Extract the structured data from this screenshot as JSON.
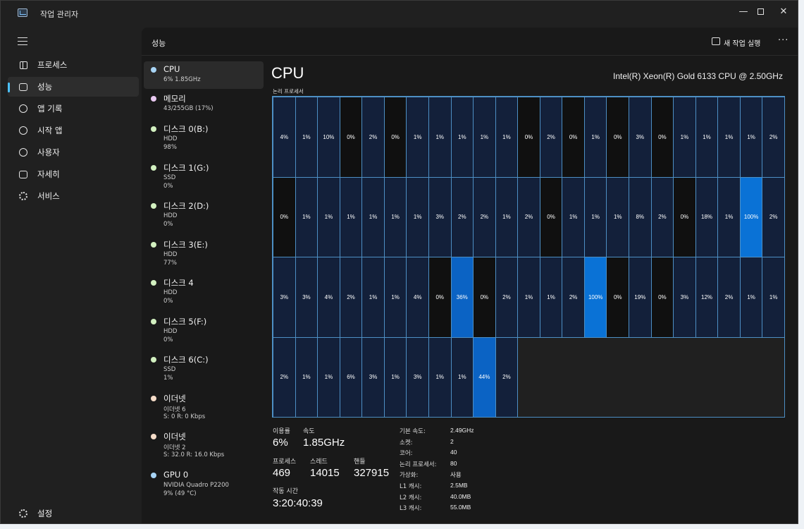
{
  "window": {
    "title": "작업 관리자",
    "min_glyph": "—",
    "close_glyph": "✕"
  },
  "nav": {
    "items": [
      {
        "label": "프로세스",
        "icon": "processes-icon"
      },
      {
        "label": "성능",
        "icon": "performance-icon",
        "active": true
      },
      {
        "label": "앱 기록",
        "icon": "app-history-icon"
      },
      {
        "label": "시작 앱",
        "icon": "startup-icon"
      },
      {
        "label": "사용자",
        "icon": "users-icon"
      },
      {
        "label": "자세히",
        "icon": "details-icon"
      },
      {
        "label": "서비스",
        "icon": "services-icon"
      }
    ],
    "settings_label": "설정"
  },
  "header": {
    "title": "성능",
    "run_task_label": "새 작업 실행",
    "more_glyph": "···"
  },
  "devices": [
    {
      "name": "CPU",
      "sub": "6% 1.85GHz",
      "sub2": "",
      "dot": "#a8d4f5",
      "active": true
    },
    {
      "name": "메모리",
      "sub": "43/255GB (17%)",
      "sub2": "",
      "dot": "#e8c8f0"
    },
    {
      "name": "디스크 0(B:)",
      "sub": "HDD",
      "sub2": "98%",
      "dot": "#d2f0c0"
    },
    {
      "name": "디스크 1(G:)",
      "sub": "SSD",
      "sub2": "0%",
      "dot": "#d2f0c0"
    },
    {
      "name": "디스크 2(D:)",
      "sub": "HDD",
      "sub2": "0%",
      "dot": "#d2f0c0"
    },
    {
      "name": "디스크 3(E:)",
      "sub": "HDD",
      "sub2": "77%",
      "dot": "#d2f0c0"
    },
    {
      "name": "디스크 4",
      "sub": "HDD",
      "sub2": "0%",
      "dot": "#d2f0c0"
    },
    {
      "name": "디스크 5(F:)",
      "sub": "HDD",
      "sub2": "0%",
      "dot": "#d2f0c0"
    },
    {
      "name": "디스크 6(C:)",
      "sub": "SSD",
      "sub2": "1%",
      "dot": "#d2f0c0"
    },
    {
      "name": "이더넷",
      "sub": "이더넷 6",
      "sub2": "S: 0 R: 0 Kbps",
      "dot": "#f5dcc8"
    },
    {
      "name": "이더넷",
      "sub": "이더넷 2",
      "sub2": "S: 32.0 R: 16.0 Kbps",
      "dot": "#f5dcc8"
    },
    {
      "name": "GPU 0",
      "sub": "NVIDIA Quadro P2200",
      "sub2": "9% (49 °C)",
      "dot": "#a8d4f5"
    }
  ],
  "cpu": {
    "title": "CPU",
    "model": "Intel(R) Xeon(R) Gold 6133 CPU @ 2.50GHz",
    "grid_label": "논리 프로세서",
    "grid_columns": 23,
    "cell_color": "#13203a",
    "peak_color": "#0b63c4",
    "idle_color": "#101010",
    "cores": [
      4,
      1,
      10,
      0,
      2,
      0,
      1,
      1,
      1,
      1,
      1,
      0,
      2,
      0,
      1,
      0,
      3,
      0,
      1,
      1,
      1,
      1,
      2,
      0,
      1,
      1,
      1,
      1,
      1,
      1,
      3,
      2,
      2,
      1,
      2,
      0,
      1,
      1,
      1,
      8,
      2,
      0,
      18,
      1,
      100,
      2,
      3,
      3,
      4,
      2,
      1,
      1,
      4,
      0,
      36,
      0,
      2,
      1,
      1,
      2,
      100,
      0,
      19,
      0,
      3,
      12,
      2,
      1,
      1,
      2,
      1,
      1,
      6,
      3,
      1,
      3,
      1,
      1,
      44,
      2
    ],
    "stats": {
      "utilization_label": "이용률",
      "utilization": "6%",
      "speed_label": "속도",
      "speed": "1.85GHz",
      "processes_label": "프로세스",
      "processes": "469",
      "threads_label": "스레드",
      "threads": "14015",
      "handles_label": "핸들",
      "handles": "327915",
      "uptime_label": "작동 시간",
      "uptime": "3:20:40:39"
    },
    "specs": [
      {
        "label": "기본 속도:",
        "value": "2.49GHz"
      },
      {
        "label": "소켓:",
        "value": "2"
      },
      {
        "label": "코어:",
        "value": "40"
      },
      {
        "label": "논리 프로세서:",
        "value": "80"
      },
      {
        "label": "가상화:",
        "value": "사용"
      },
      {
        "label": "L1 캐시:",
        "value": "2.5MB"
      },
      {
        "label": "L2 캐시:",
        "value": "40.0MB"
      },
      {
        "label": "L3 캐시:",
        "value": "55.0MB"
      }
    ]
  }
}
